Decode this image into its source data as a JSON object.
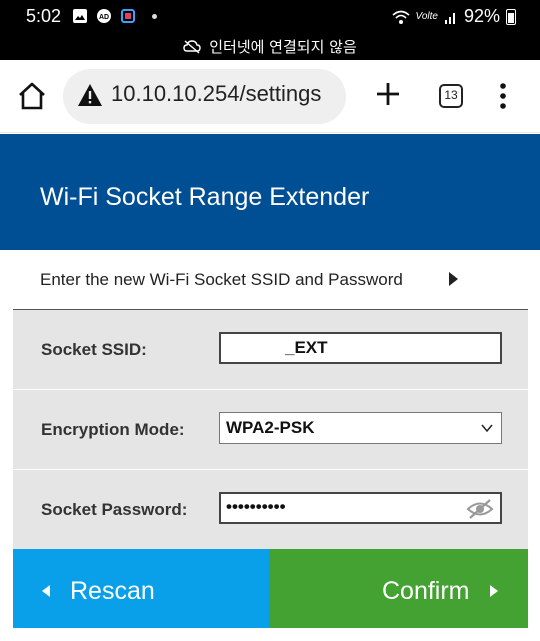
{
  "status_bar": {
    "time": "5:02",
    "battery": "92%",
    "volte": "Volte",
    "offline_notice": "인터넷에 연결되지 않음"
  },
  "browser": {
    "url": "10.10.10.254/settings",
    "tab_count": "13"
  },
  "page": {
    "title": "Wi-Fi Socket Range Extender",
    "instruction": "Enter the new Wi-Fi Socket SSID and Password"
  },
  "form": {
    "ssid_label": "Socket SSID:",
    "ssid_value": "_EXT",
    "encryption_label": "Encryption Mode:",
    "encryption_value": "WPA2-PSK",
    "password_label": "Socket Password:",
    "password_masked": "••••••••••"
  },
  "buttons": {
    "rescan": "Rescan",
    "confirm": "Confirm"
  },
  "colors": {
    "header_bg": "#004f95",
    "rescan_bg": "#0aa0e9",
    "confirm_bg": "#43a232",
    "form_bg": "#e5e5e5"
  }
}
